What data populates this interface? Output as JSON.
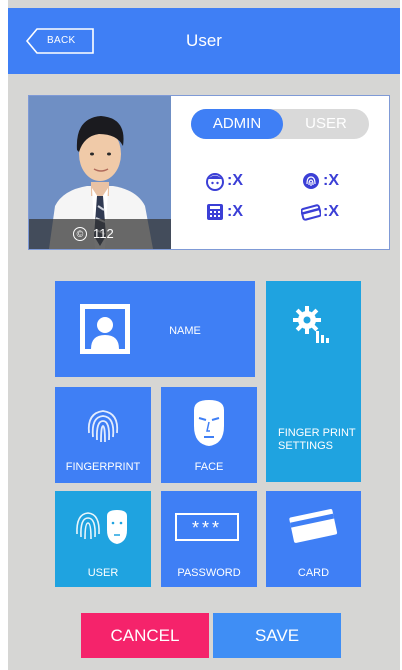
{
  "header": {
    "back_label": "BACK",
    "title": "User"
  },
  "profile": {
    "id_icon_text": "©",
    "id_number": "112",
    "role_toggle": {
      "admin_label": "ADMIN",
      "user_label": "USER",
      "selected": "ADMIN"
    },
    "status": {
      "face": ":X",
      "fingerprint": ":X",
      "password": ":X",
      "card": ":X"
    }
  },
  "tiles": {
    "name": "NAME",
    "fingerprint_settings": "FINGER PRINT SETTINGS",
    "fingerprint": "FINGERPRINT",
    "face": "FACE",
    "user": "USER",
    "password": "PASSWORD",
    "password_mask": "***",
    "card": "CARD"
  },
  "actions": {
    "cancel_label": "CANCEL",
    "save_label": "SAVE"
  },
  "colors": {
    "primary": "#3f7ff5",
    "secondary_tile": "#1fa3e0",
    "cancel": "#f5236b",
    "status_text": "#3b3fd6"
  }
}
